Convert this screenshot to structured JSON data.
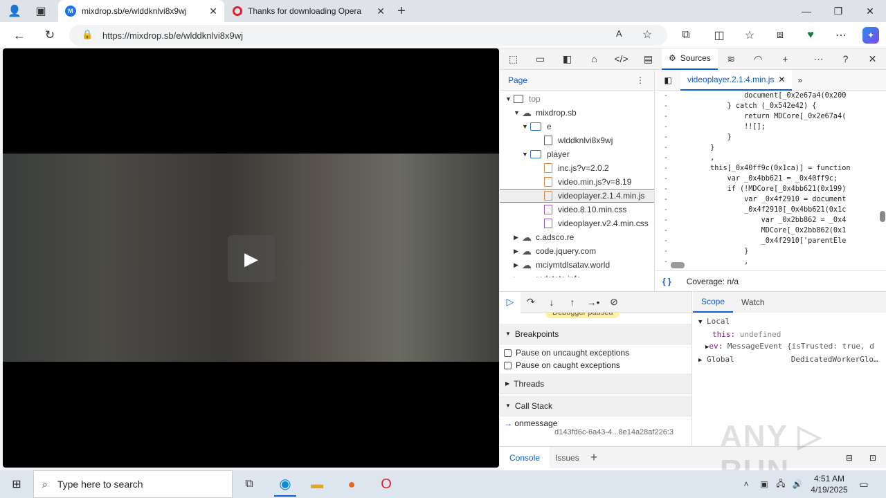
{
  "browser": {
    "tabs": [
      {
        "title": "mixdrop.sb/e/wlddknlvi8x9wj",
        "active": true
      },
      {
        "title": "Thanks for downloading Opera",
        "active": false
      }
    ],
    "url": "https://mixdrop.sb/e/wlddknlvi8x9wj"
  },
  "devtools": {
    "active_panel": "Sources",
    "navigator": {
      "tab": "Page",
      "tree": [
        {
          "label": "top",
          "level": 0,
          "type": "frame",
          "open": true
        },
        {
          "label": "mixdrop.sb",
          "level": 1,
          "type": "domain",
          "open": true
        },
        {
          "label": "e",
          "level": 2,
          "type": "folder",
          "open": true
        },
        {
          "label": "wlddknlvi8x9wj",
          "level": 3,
          "type": "doc"
        },
        {
          "label": "player",
          "level": 2,
          "type": "folder",
          "open": true
        },
        {
          "label": "inc.js?v=2.0.2",
          "level": 3,
          "type": "js"
        },
        {
          "label": "video.min.js?v=8.19",
          "level": 3,
          "type": "js"
        },
        {
          "label": "videoplayer.2.1.4.min.js",
          "level": 3,
          "type": "js",
          "selected": true
        },
        {
          "label": "video.8.10.min.css",
          "level": 3,
          "type": "css"
        },
        {
          "label": "videoplayer.v2.4.min.css",
          "level": 3,
          "type": "css"
        },
        {
          "label": "c.adsco.re",
          "level": 1,
          "type": "domain",
          "open": false
        },
        {
          "label": "code.jquery.com",
          "level": 1,
          "type": "domain",
          "open": false
        },
        {
          "label": "mciymtdlsatav.world",
          "level": 1,
          "type": "domain",
          "open": false
        },
        {
          "label": "redstats.info",
          "level": 1,
          "type": "domain",
          "open": false
        }
      ]
    },
    "editor": {
      "file_tab": "videoplayer.2.1.4.min.js",
      "coverage": "Coverage: n/a",
      "code": [
        "                document[_0x2e67a4(0x200",
        "            } catch (_0x542e42) {",
        "                return MDCore[_0x2e67a4(",
        "                !![];",
        "            }",
        "        }",
        "        ,",
        "        this[_0x40ff9c(0x1ca)] = function",
        "            var _0x4bb621 = _0x40ff9c;",
        "            if (!MDCore[_0x4bb621(0x199)",
        "                var _0x4f2910 = document",
        "                _0x4f2910[_0x4bb621(0x1c",
        "                    var _0x2bb862 = _0x4",
        "                    MDCore[_0x2bb862(0x1",
        "                    _0x4f2910['parentEle",
        "                }",
        "                ,"
      ]
    },
    "debugger": {
      "paused_banner": "Debugger paused",
      "breakpoints": "Breakpoints",
      "pause_uncaught": "Pause on uncaught exceptions",
      "pause_caught": "Pause on caught exceptions",
      "threads": "Threads",
      "call_stack": "Call Stack",
      "frame_name": "onmessage",
      "frame_loc": "d143fd6c-6a43-4...8e14a28af226:3"
    },
    "scope": {
      "tabs": [
        "Scope",
        "Watch"
      ],
      "local": "Local",
      "this_key": "this:",
      "this_val": "undefined",
      "ev_key": "ev:",
      "ev_val": "MessageEvent {isTrusted: true, d",
      "global": "Global",
      "global_val": "DedicatedWorkerGlo…"
    },
    "drawer": {
      "tabs": [
        "Console",
        "Issues"
      ]
    }
  },
  "taskbar": {
    "search_placeholder": "Type here to search",
    "time": "4:51 AM",
    "date": "4/19/2025"
  },
  "watermark": "ANY RUN"
}
